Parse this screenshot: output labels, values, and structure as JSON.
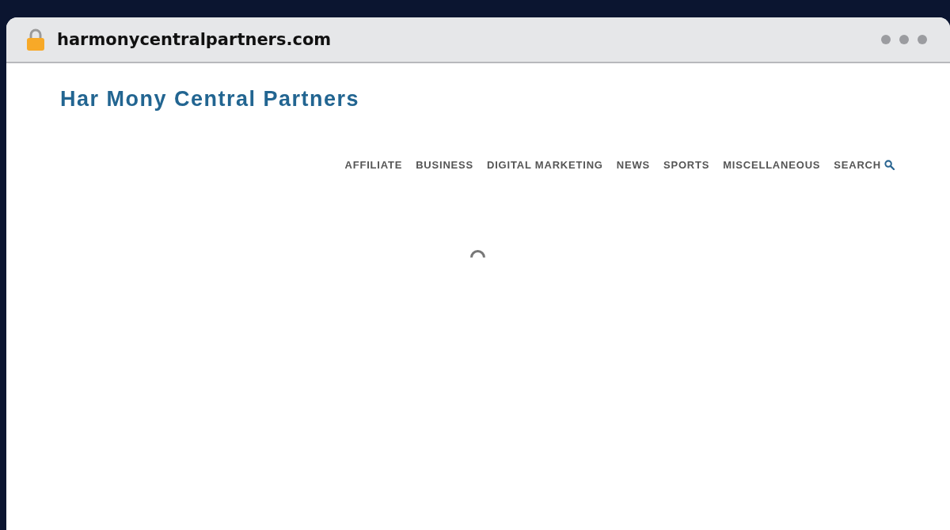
{
  "browser": {
    "url": "harmonycentralpartners.com"
  },
  "site": {
    "title": "Har Mony Central Partners",
    "nav": [
      {
        "label": "AFFILIATE",
        "kind": "link"
      },
      {
        "label": "BUSINESS",
        "kind": "link"
      },
      {
        "label": "DIGITAL MARKETING",
        "kind": "link"
      },
      {
        "label": "NEWS",
        "kind": "link"
      },
      {
        "label": "SPORTS",
        "kind": "link"
      },
      {
        "label": "MISCELLANEOUS",
        "kind": "link"
      },
      {
        "label": "SEARCH",
        "kind": "search"
      }
    ]
  }
}
